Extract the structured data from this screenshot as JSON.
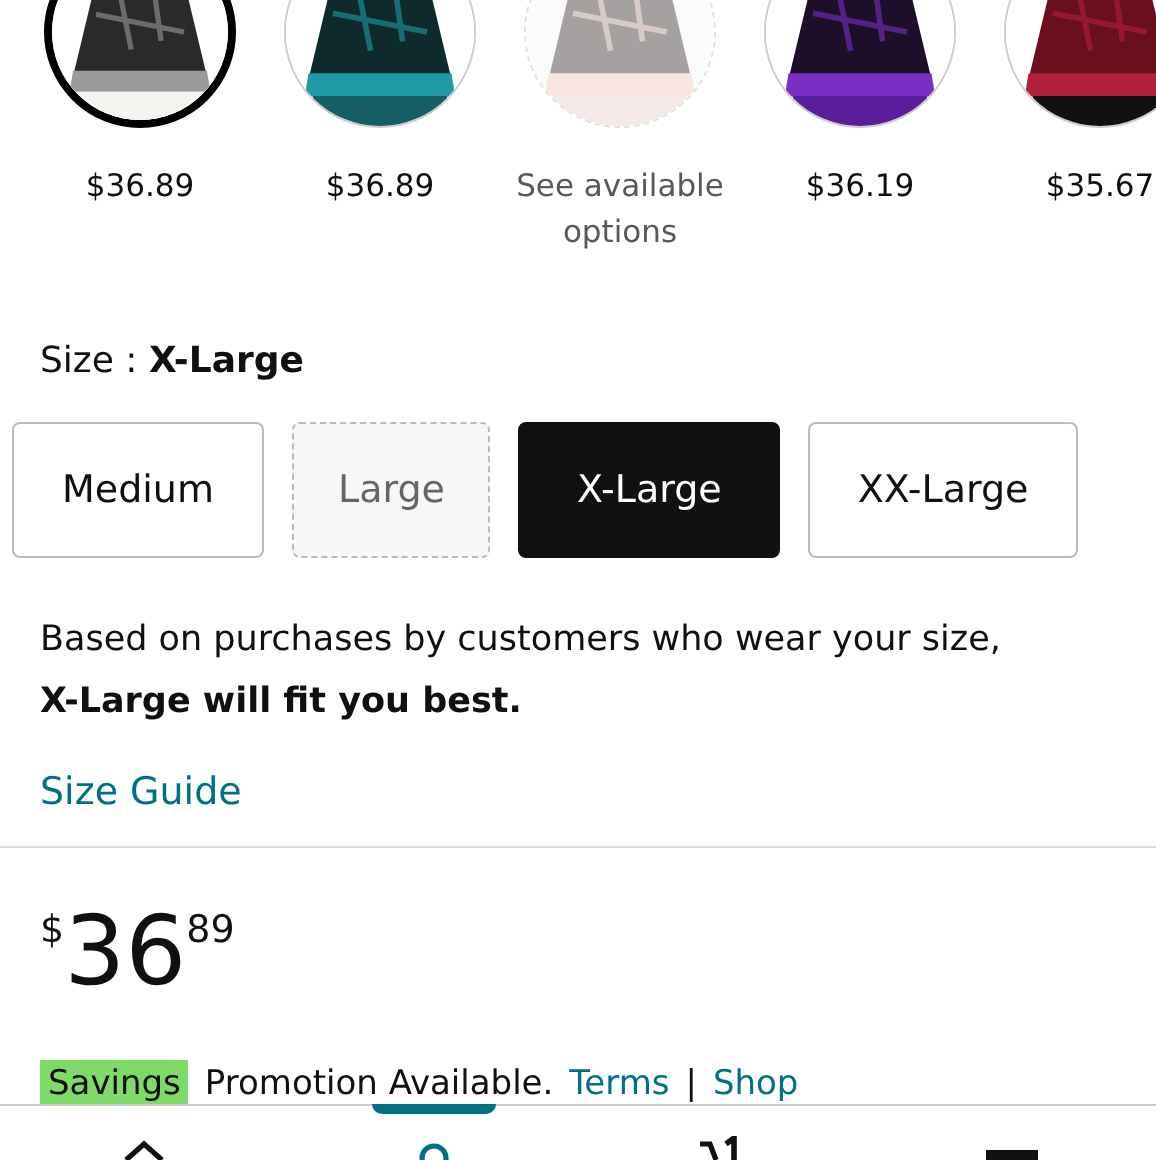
{
  "color_options": [
    {
      "kind": "picture",
      "price": "$36.89",
      "selected": true,
      "available": true
    },
    {
      "kind": "picture",
      "price": "$36.89",
      "selected": false,
      "available": true
    },
    {
      "kind": "picture",
      "price": "See available options",
      "selected": false,
      "available": false
    },
    {
      "kind": "picture",
      "price": "$36.19",
      "selected": false,
      "available": true
    },
    {
      "kind": "picture",
      "price": "$35.67",
      "selected": false,
      "available": true
    }
  ],
  "size": {
    "label": "Size :",
    "value": "X-Large"
  },
  "size_options": [
    {
      "label": "Medium",
      "selected": false,
      "available": true
    },
    {
      "label": "Large",
      "selected": false,
      "available": false
    },
    {
      "label": "X-Large",
      "selected": true,
      "available": true
    },
    {
      "label": "XX-Large",
      "selected": false,
      "available": true
    }
  ],
  "fit_note": "Based on purchases by customers who wear your size, **X-Large will fit you best.**",
  "size_guide_link": "Size Guide",
  "price": {
    "symbol": "$",
    "whole": "36",
    "fraction": "89"
  },
  "promotion": {
    "badge": "Savings",
    "text": "Promotion Available.",
    "terms_link": "Terms",
    "separator": "|",
    "shop_link": "Shop"
  },
  "bottom_nav": [
    {
      "kind": "home",
      "selected": false
    },
    {
      "kind": "account",
      "selected": true
    },
    {
      "kind": "cart",
      "selected": false
    },
    {
      "kind": "menu",
      "selected": false
    }
  ]
}
